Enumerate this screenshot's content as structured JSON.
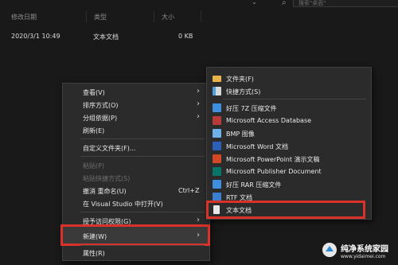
{
  "explorer": {
    "search_placeholder": "搜索\"桌面\"",
    "columns": [
      "修改日期",
      "类型",
      "大小"
    ],
    "file": {
      "date": "2020/3/1 10:49",
      "type": "文本文档",
      "size": "0 KB"
    }
  },
  "context_menu": {
    "items": [
      {
        "label": "查看(V)",
        "arrow": true
      },
      {
        "label": "排序方式(O)",
        "arrow": true
      },
      {
        "label": "分组依据(P)",
        "arrow": true
      },
      {
        "label": "刷新(E)"
      },
      {
        "label": "自定义文件夹(F)..."
      },
      {
        "label": "粘贴(P)",
        "disabled": true
      },
      {
        "label": "粘贴快捷方式(S)",
        "disabled": true
      },
      {
        "label": "撤消 重命名(U)",
        "shortcut": "Ctrl+Z"
      },
      {
        "label": "在 Visual Studio 中打开(V)"
      },
      {
        "label": "授予访问权限(G)",
        "arrow": true
      },
      {
        "label": "新建(W)",
        "arrow": true
      },
      {
        "label": "属性(R)"
      }
    ]
  },
  "submenu": {
    "items": [
      {
        "label": "文件夹(F)",
        "icon": "folder-icon",
        "color": "#e8b34b"
      },
      {
        "label": "快捷方式(S)",
        "icon": "shortcut-icon",
        "color": "#4aa3e0"
      },
      {
        "label": "好压 7Z 压缩文件",
        "icon": "haozip-icon",
        "color": "#3f8fe0"
      },
      {
        "label": "Microsoft Access Database",
        "icon": "access-icon",
        "color": "#b83a3a"
      },
      {
        "label": "BMP 图像",
        "icon": "bmp-icon",
        "color": "#6fb0e8"
      },
      {
        "label": "Microsoft Word 文档",
        "icon": "word-icon",
        "color": "#2b5fb8"
      },
      {
        "label": "Microsoft PowerPoint 演示文稿",
        "icon": "powerpoint-icon",
        "color": "#d24726"
      },
      {
        "label": "Microsoft Publisher Document",
        "icon": "publisher-icon",
        "color": "#077568"
      },
      {
        "label": "好压 RAR 压缩文件",
        "icon": "haozip-rar-icon",
        "color": "#3f8fe0"
      },
      {
        "label": "RTF 文档",
        "icon": "rtf-icon",
        "color": "#3c7fd0"
      },
      {
        "label": "文本文档",
        "icon": "text-file-icon",
        "color": "#e8e8e8"
      }
    ]
  },
  "watermark": {
    "text": "纯净系统家园",
    "url": "www.yidaimei.com"
  }
}
